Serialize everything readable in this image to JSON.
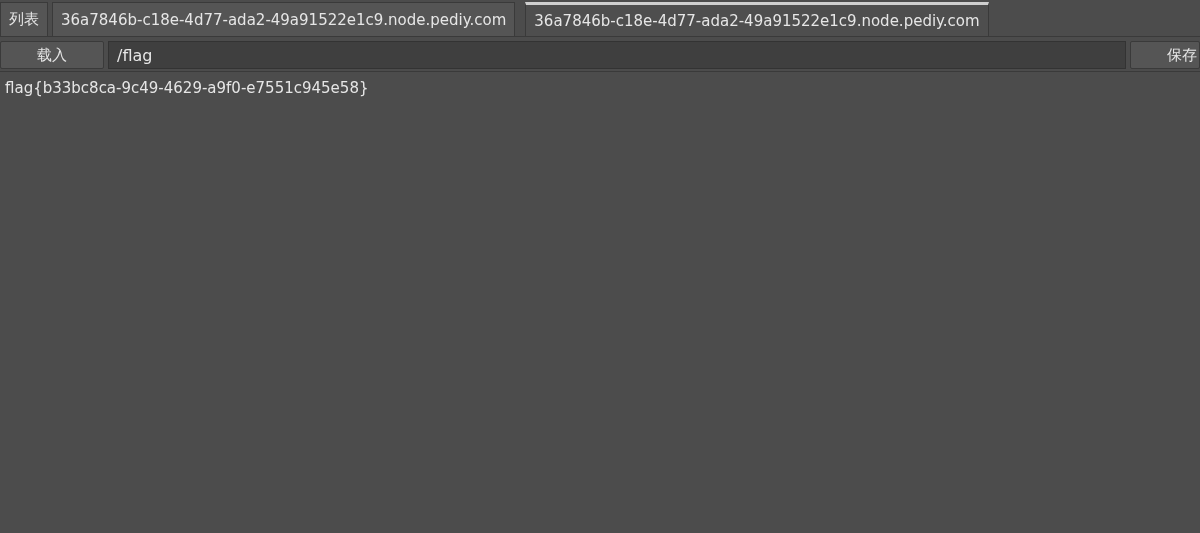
{
  "tabs": [
    {
      "label": "列表",
      "selected": false
    },
    {
      "label": "36a7846b-c18e-4d77-ada2-49a91522e1c9.node.pediy.com",
      "selected": false
    },
    {
      "label": "36a7846b-c18e-4d77-ada2-49a91522e1c9.node.pediy.com",
      "selected": true
    }
  ],
  "toolbar": {
    "load_button": "载入",
    "path_field": {
      "value": "/flag"
    },
    "save_button": "保存"
  },
  "content": {
    "text": "flag{b33bc8ca-9c49-4629-a9f0-e7551c945e58}"
  }
}
